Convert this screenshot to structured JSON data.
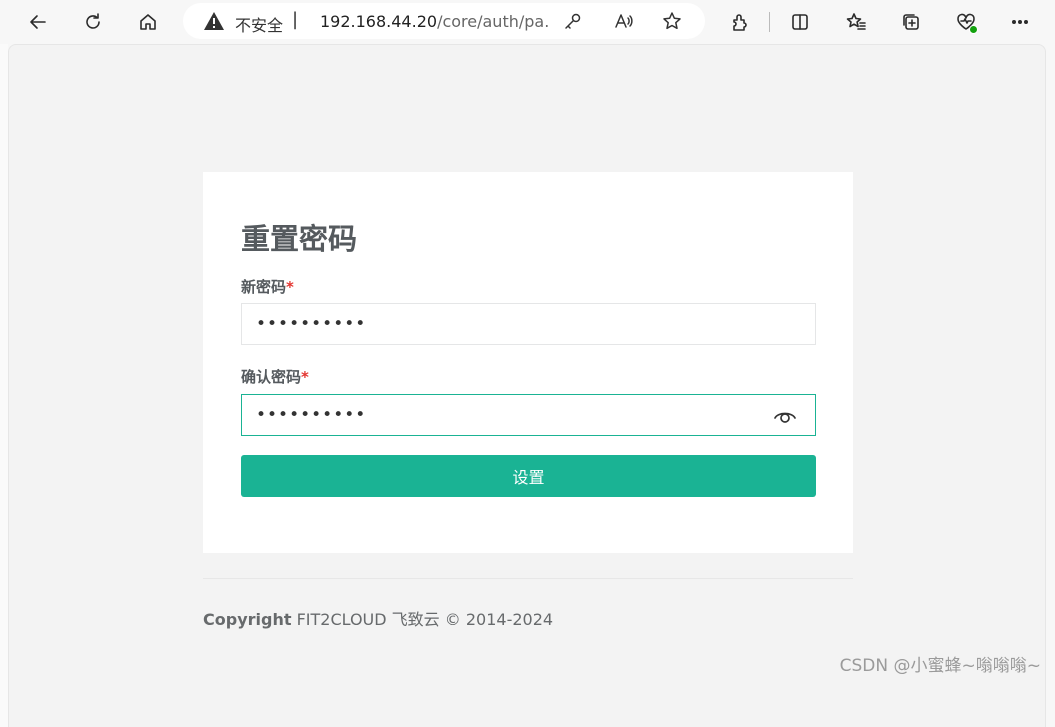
{
  "browser": {
    "security_label": "不安全",
    "separator": "|",
    "url_host": "192.168.44.20",
    "url_path": "/core/auth/pa..."
  },
  "card": {
    "title": "重置密码",
    "new_password": {
      "label": "新密码",
      "required_mark": "*",
      "value": "••••••••••"
    },
    "confirm_password": {
      "label": "确认密码",
      "required_mark": "*",
      "value": "••••••••••"
    },
    "submit_label": "设置"
  },
  "footer": {
    "copyright_bold": "Copyright",
    "copyright_rest": " FIT2CLOUD 飞致云 © 2014-2024"
  },
  "watermark": "CSDN @小蜜蜂~嗡嗡嗡~",
  "colors": {
    "accent": "#1ab394",
    "required": "#e3342f",
    "text": "#555a5e"
  }
}
